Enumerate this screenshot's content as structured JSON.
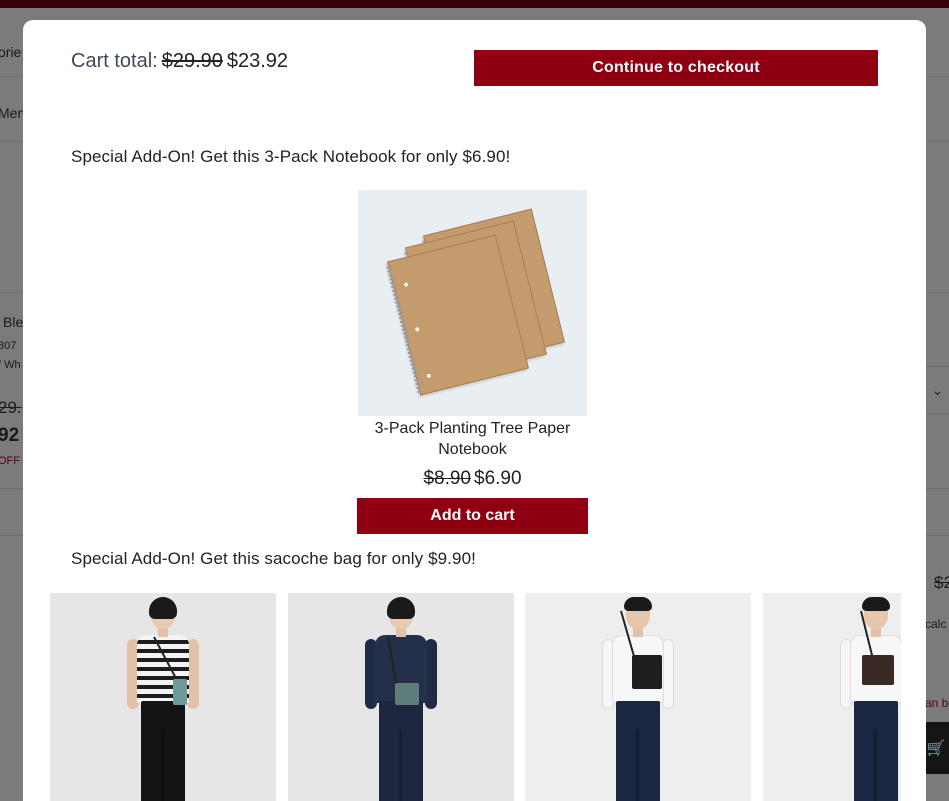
{
  "background": {
    "fragments": [
      "orie",
      "Men",
      "Ble",
      "807",
      "f Wh",
      "29.",
      "92",
      "OFF (",
      "$2",
      "calc",
      "an b"
    ]
  },
  "modal": {
    "cart_total": {
      "label": "Cart total:",
      "original_price": "$29.90",
      "current_price": "$23.92"
    },
    "checkout_button": "Continue to checkout",
    "offers": [
      {
        "title": "Special Add-On! Get this 3-Pack Notebook for only $6.90!",
        "product": {
          "name": "3-Pack Planting Tree Paper Notebook",
          "original_price": "$8.90",
          "current_price": "$6.90",
          "button": "Add to cart"
        }
      },
      {
        "title": "Special Add-On! Get this sacoche bag for only $9.90!",
        "products": [
          {
            "image": "model-striped-top-teal-bag"
          },
          {
            "image": "model-denim-jacket-teal-bag"
          },
          {
            "image": "model-white-top-black-bag"
          },
          {
            "image": "model-white-top-brown-bag"
          }
        ]
      }
    ]
  },
  "colors": {
    "accent": "#8e0011",
    "overlay": "#7b7b7b",
    "text": "#222222"
  }
}
